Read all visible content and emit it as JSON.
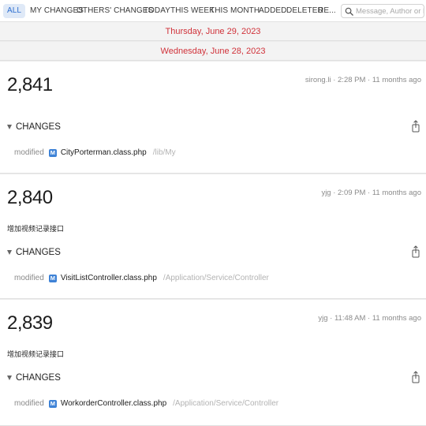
{
  "filters": [
    "ALL",
    "MY CHANGES",
    "OTHERS' CHANGES",
    "TODAY",
    "THIS WEEK",
    "THIS MONTH",
    "ADDED",
    "DELETED",
    "RE..."
  ],
  "search": {
    "placeholder": "Message, Author or File"
  },
  "dates": [
    "Thursday, June 29, 2023",
    "Wednesday, June 28, 2023"
  ],
  "commits": [
    {
      "revision": "2,841",
      "meta": "sirong.li · 2:28 PM · 11 months ago",
      "message": "",
      "changes_label": "CHANGES",
      "files": [
        {
          "status": "modified",
          "badge": "M",
          "name": "CityPorterman.class.php",
          "path": "/lib/My"
        }
      ]
    },
    {
      "revision": "2,840",
      "meta": "yjg · 2:09 PM · 11 months ago",
      "message": "增加视频记录接口",
      "changes_label": "CHANGES",
      "files": [
        {
          "status": "modified",
          "badge": "M",
          "name": "VisitListController.class.php",
          "path": "/Application/Service/Controller"
        }
      ]
    },
    {
      "revision": "2,839",
      "meta": "yjg · 11:48 AM · 11 months ago",
      "message": "增加视频记录接口",
      "changes_label": "CHANGES",
      "files": [
        {
          "status": "modified",
          "badge": "M",
          "name": "WorkorderController.class.php",
          "path": "/Application/Service/Controller"
        }
      ]
    }
  ]
}
